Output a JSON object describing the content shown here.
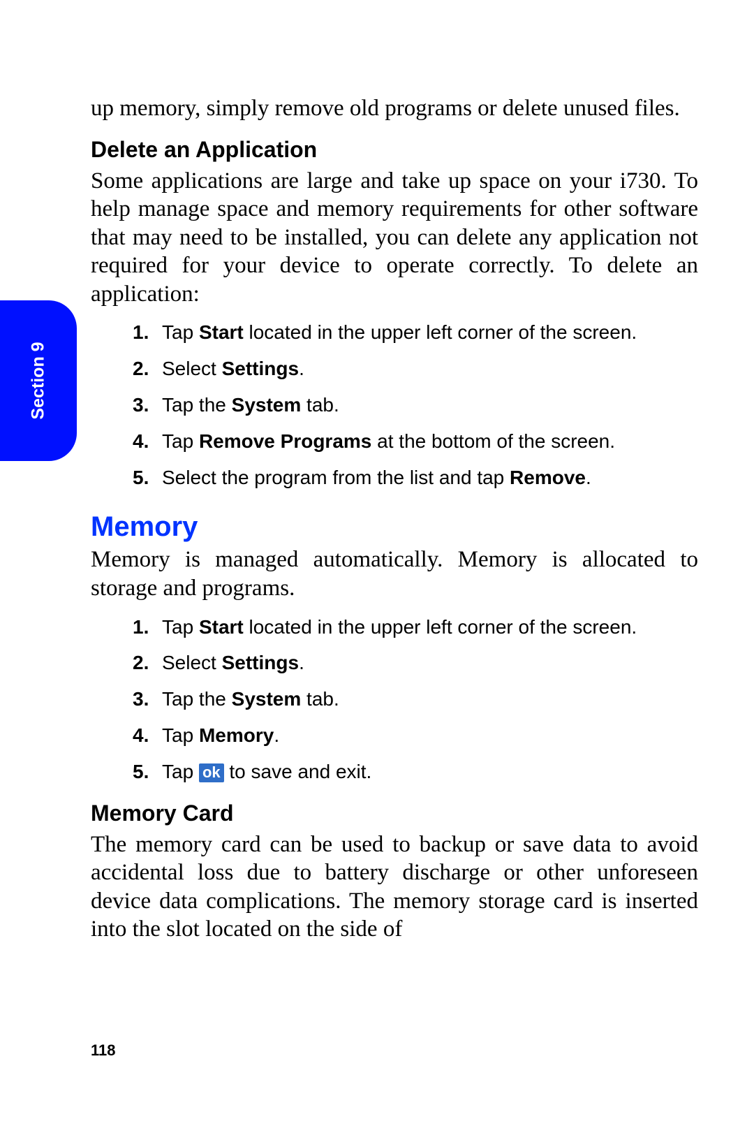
{
  "tab": {
    "label": "Section 9"
  },
  "intro_line": "up memory, simply remove old programs or delete unused files.",
  "delete_app": {
    "heading": "Delete an Application",
    "paragraph": "Some applications are large and take up space on your i730. To help manage space and memory requirements for other software that may need to be installed, you can delete any application not required for your device to operate correctly. To delete an application:",
    "steps": {
      "s1_pre": "Tap ",
      "s1_b": "Start",
      "s1_post": " located in the upper left corner of the screen.",
      "s2_pre": "Select ",
      "s2_b": "Settings",
      "s2_post": ".",
      "s3_pre": "Tap the ",
      "s3_b": "System",
      "s3_post": " tab.",
      "s4_pre": "Tap ",
      "s4_b": "Remove Programs",
      "s4_post": " at the bottom of the screen.",
      "s5_pre": "Select the program from the list and tap ",
      "s5_b": "Remove",
      "s5_post": "."
    }
  },
  "memory": {
    "heading": "Memory",
    "paragraph": "Memory is managed automatically. Memory is allocated to storage and programs.",
    "steps": {
      "s1_pre": "Tap ",
      "s1_b": "Start",
      "s1_post": " located in the upper left corner of the screen.",
      "s2_pre": "Select ",
      "s2_b": "Settings",
      "s2_post": ".",
      "s3_pre": "Tap the ",
      "s3_b": "System",
      "s3_post": " tab.",
      "s4_pre": "Tap ",
      "s4_b": "Memory",
      "s4_post": ".",
      "s5_pre": "Tap ",
      "s5_badge": "ok",
      "s5_post": " to save and exit."
    }
  },
  "memory_card": {
    "heading": "Memory Card",
    "paragraph": "The memory card can be used to backup or save data to avoid accidental loss due to battery discharge or other unforeseen device data complications. The memory storage card is inserted into the slot located on the side of"
  },
  "page_number": "118"
}
